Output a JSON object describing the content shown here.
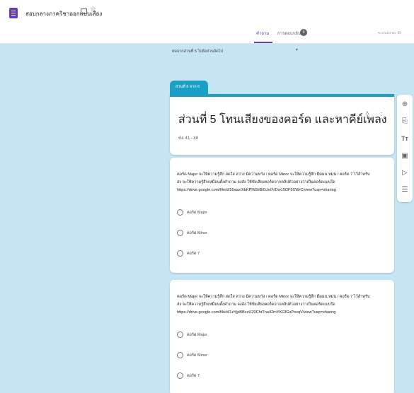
{
  "header": {
    "doc_title": "สอบกลางภาคริชาออกแบบเสียง",
    "icons": [
      "forms-app-icon",
      "folder-icon",
      "star-icon"
    ]
  },
  "tabs": {
    "questions": "คำถาม",
    "responses": "การตอบกลับ",
    "responses_count": "9",
    "points": "คะแนนรวม: 65"
  },
  "canvas": {
    "after_section": "ต่อจากส่วนที่ 5  ไปยังส่วนถัดไป"
  },
  "section": {
    "tab_label": "ส่วนที่ 6 จาก 6",
    "title": "ส่วนที่ 5 โทนเสียงของคอร์ด และหาคีย์เพลง",
    "description": "ข้อ 41 - 48"
  },
  "questions": [
    {
      "lines": [
        "คอร์ด Major จะให้ความรู้สึก สดใส สว่าง มีความหวัง / คอร์ด Minor จะให้ความรู้สึก มืดมน หม่น / คอร์ด 7 ไว้สำหรับ",
        "ส่ง จะให้ความรู้สึกเหมือนตั้งคำถาม ลงลัง ให้ฟังเสียงคอร์ดจากคลิปตัวอย่างว่าเป็นคอร์ดแบบใด",
        "https://drive.google.com/file/d/16aaxIXbKPlN5tiBlGJe0VDw15DF9XWrC/view?usp=sharing"
      ],
      "options": [
        "คอร์ด Major",
        "คอร์ด Minor",
        "คอร์ด 7"
      ]
    },
    {
      "lines": [
        "คอร์ด Major จะให้ความรู้สึก สดใส สว่าง มีความหวัง / คอร์ด Minor จะให้ความรู้สึก มืดมน หม่น / คอร์ด 7 ไว้สำหรับ",
        "ส่ง จะให้ความรู้สึกเหมือนตั้งคำถาม ลงลัง ให้ฟังเสียงคอร์ดจากคลิปตัวอย่างว่าเป็นคอร์ดแบบใด",
        "https://drive.google.com/file/d/1zYjpBBczU20ChtTna42mYKGfGsPexqV/view?usp=sharing"
      ],
      "options": [
        "คอร์ด Major",
        "คอร์ด Minor",
        "คอร์ด 7"
      ]
    }
  ],
  "toolbar": {
    "tools": [
      "add-question-icon",
      "import-questions-icon",
      "add-title-icon",
      "add-image-icon",
      "add-video-icon",
      "add-section-icon"
    ]
  },
  "colors": {
    "theme": "#1aa0c5",
    "background": "#c5e4f4",
    "brand": "#673ab7"
  }
}
